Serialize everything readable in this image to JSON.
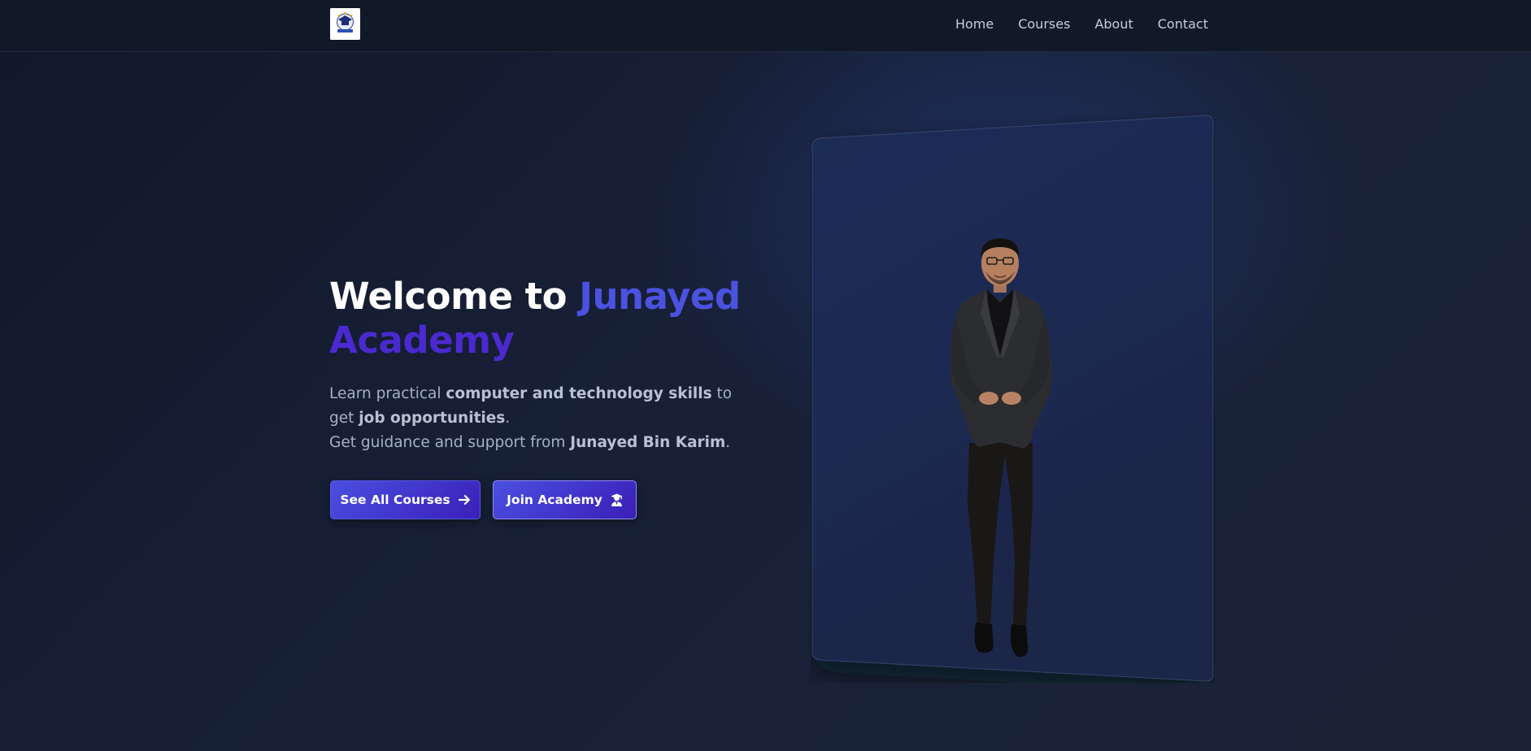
{
  "nav": {
    "logo_alt": "Junayed Academy logo",
    "links": [
      "Home",
      "Courses",
      "About",
      "Contact"
    ]
  },
  "hero": {
    "title_prefix": "Welcome to",
    "brand_word_1": "Junayed",
    "brand_word_2": "Academy",
    "desc_part1": "Learn practical",
    "desc_bold1": "computer and technology skills",
    "desc_part2": "to get",
    "desc_bold2": "job opportunities",
    "desc_part3": ".",
    "desc_part4": "Get guidance and support from",
    "desc_bold3": "Junayed Bin Karim",
    "desc_part5": "."
  },
  "buttons": {
    "primary_label": "See All Courses",
    "primary_icon": "arrow-right-icon",
    "secondary_label": "Join Academy",
    "secondary_icon": "graduate-icon"
  },
  "image": {
    "alt": "Junayed Bin Karim standing in a dark suit"
  },
  "colors": {
    "background": "#151c2e",
    "navbar": "#111827",
    "brand_blue": "#4b52e0",
    "brand_purple": "#4a2ad0",
    "button_gradient_start": "#4a4fe0",
    "button_gradient_end": "#3a1fb8"
  }
}
